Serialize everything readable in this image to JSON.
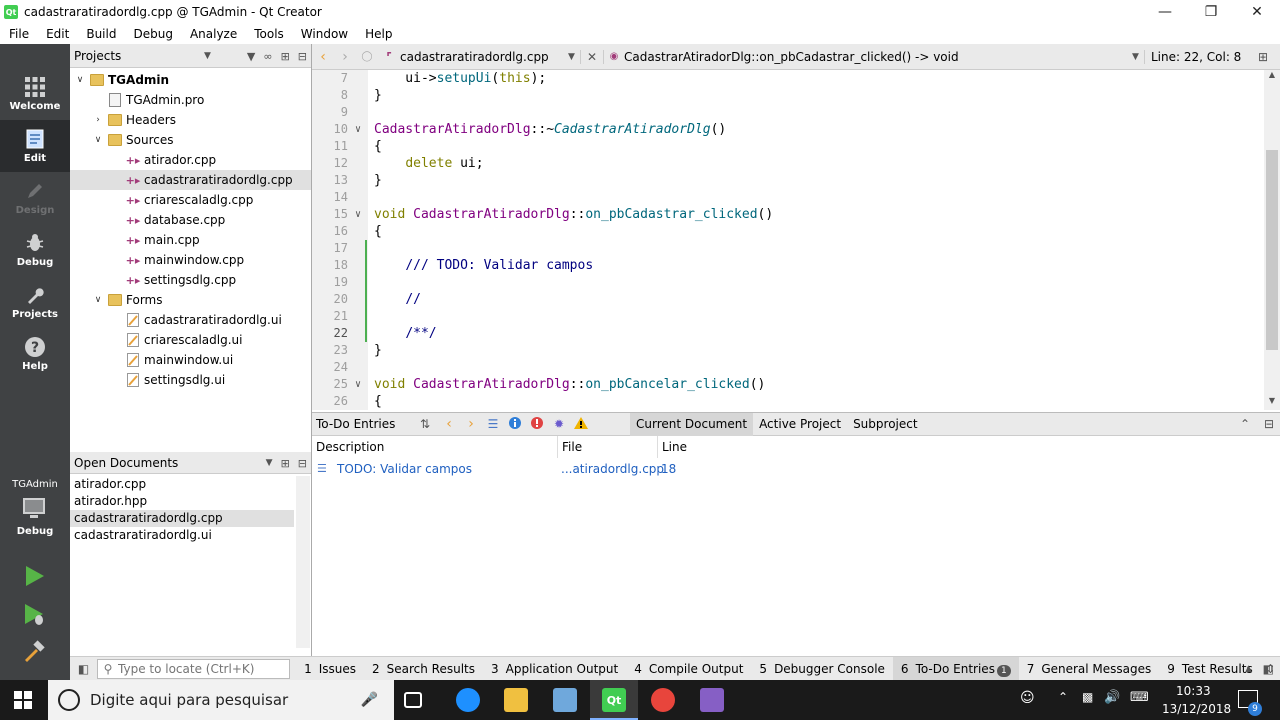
{
  "window": {
    "title": "cadastraratiradordlg.cpp @ TGAdmin - Qt Creator"
  },
  "menu": [
    "File",
    "Edit",
    "Build",
    "Debug",
    "Analyze",
    "Tools",
    "Window",
    "Help"
  ],
  "modes": [
    {
      "label": "Welcome",
      "icon": "grid-icon"
    },
    {
      "label": "Edit",
      "icon": "document-icon"
    },
    {
      "label": "Design",
      "icon": "pencil-icon"
    },
    {
      "label": "Debug",
      "icon": "bug-icon"
    },
    {
      "label": "Projects",
      "icon": "wrench-icon"
    },
    {
      "label": "Help",
      "icon": "question-icon"
    }
  ],
  "kit": {
    "project": "TGAdmin",
    "build": "Debug"
  },
  "projects_pane": {
    "title": "Projects",
    "tree": [
      {
        "label": "TGAdmin",
        "level": 0,
        "type": "project",
        "expanded": true
      },
      {
        "label": "TGAdmin.pro",
        "level": 1,
        "type": "pro"
      },
      {
        "label": "Headers",
        "level": 1,
        "type": "folder",
        "expanded": false
      },
      {
        "label": "Sources",
        "level": 1,
        "type": "folder",
        "expanded": true
      },
      {
        "label": "atirador.cpp",
        "level": 2,
        "type": "cpp"
      },
      {
        "label": "cadastraratiradordlg.cpp",
        "level": 2,
        "type": "cpp",
        "selected": true
      },
      {
        "label": "criarescaladlg.cpp",
        "level": 2,
        "type": "cpp"
      },
      {
        "label": "database.cpp",
        "level": 2,
        "type": "cpp"
      },
      {
        "label": "main.cpp",
        "level": 2,
        "type": "cpp"
      },
      {
        "label": "mainwindow.cpp",
        "level": 2,
        "type": "cpp"
      },
      {
        "label": "settingsdlg.cpp",
        "level": 2,
        "type": "cpp"
      },
      {
        "label": "Forms",
        "level": 1,
        "type": "folder",
        "expanded": true
      },
      {
        "label": "cadastraratiradordlg.ui",
        "level": 2,
        "type": "ui"
      },
      {
        "label": "criarescaladlg.ui",
        "level": 2,
        "type": "ui"
      },
      {
        "label": "mainwindow.ui",
        "level": 2,
        "type": "ui"
      },
      {
        "label": "settingsdlg.ui",
        "level": 2,
        "type": "ui"
      }
    ]
  },
  "open_documents": {
    "title": "Open Documents",
    "items": [
      "atirador.cpp",
      "atirador.hpp",
      "cadastraratiradordlg.cpp",
      "cadastraratiradordlg.ui"
    ],
    "selected": 2
  },
  "editor_toolbar": {
    "file": "cadastraratiradordlg.cpp",
    "symbol": "CadastrarAtiradorDlg::on_pbCadastrar_clicked() -> void",
    "position": "Line: 22, Col: 8"
  },
  "code_lines": [
    {
      "n": "7",
      "fold": "",
      "segs": [
        [
          "",
          "    ui->"
        ],
        [
          "fn",
          "setupUi"
        ],
        [
          "",
          "("
        ],
        [
          "kw",
          "this"
        ],
        [
          "",
          ");"
        ]
      ]
    },
    {
      "n": "8",
      "fold": "",
      "segs": [
        [
          "",
          "}"
        ]
      ]
    },
    {
      "n": "9",
      "fold": "",
      "segs": []
    },
    {
      "n": "10",
      "fold": "v",
      "segs": [
        [
          "cls",
          "CadastrarAtiradorDlg"
        ],
        [
          "",
          "::~"
        ],
        [
          "fni",
          "CadastrarAtiradorDlg"
        ],
        [
          "",
          "()"
        ]
      ]
    },
    {
      "n": "11",
      "fold": "",
      "segs": [
        [
          "",
          "{"
        ]
      ]
    },
    {
      "n": "12",
      "fold": "",
      "segs": [
        [
          "",
          "    "
        ],
        [
          "kw",
          "delete"
        ],
        [
          "",
          " ui;"
        ]
      ]
    },
    {
      "n": "13",
      "fold": "",
      "segs": [
        [
          "",
          "}"
        ]
      ]
    },
    {
      "n": "14",
      "fold": "",
      "segs": []
    },
    {
      "n": "15",
      "fold": "v",
      "segs": [
        [
          "kw",
          "void"
        ],
        [
          "",
          " "
        ],
        [
          "cls",
          "CadastrarAtiradorDlg"
        ],
        [
          "",
          "::"
        ],
        [
          "fn",
          "on_pbCadastrar_clicked"
        ],
        [
          "",
          "()"
        ]
      ]
    },
    {
      "n": "16",
      "fold": "",
      "segs": [
        [
          "",
          "{"
        ]
      ]
    },
    {
      "n": "17",
      "fold": "",
      "segs": [],
      "changed": true
    },
    {
      "n": "18",
      "fold": "",
      "segs": [
        [
          "",
          "    "
        ],
        [
          "cmt",
          "/// TODO: Validar campos"
        ]
      ],
      "changed": true
    },
    {
      "n": "19",
      "fold": "",
      "segs": [],
      "changed": true
    },
    {
      "n": "20",
      "fold": "",
      "segs": [
        [
          "",
          "    "
        ],
        [
          "cmt",
          "//"
        ]
      ],
      "changed": true
    },
    {
      "n": "21",
      "fold": "",
      "segs": [],
      "changed": true
    },
    {
      "n": "22",
      "fold": "",
      "segs": [
        [
          "",
          "    "
        ],
        [
          "cmt",
          "/**/"
        ]
      ],
      "changed": true,
      "current": true
    },
    {
      "n": "23",
      "fold": "",
      "segs": [
        [
          "",
          "}"
        ]
      ]
    },
    {
      "n": "24",
      "fold": "",
      "segs": []
    },
    {
      "n": "25",
      "fold": "v",
      "segs": [
        [
          "kw",
          "void"
        ],
        [
          "",
          " "
        ],
        [
          "cls",
          "CadastrarAtiradorDlg"
        ],
        [
          "",
          "::"
        ],
        [
          "fn",
          "on_pbCancelar_clicked"
        ],
        [
          "",
          "()"
        ]
      ]
    },
    {
      "n": "26",
      "fold": "",
      "segs": [
        [
          "",
          "{"
        ]
      ]
    }
  ],
  "todo": {
    "title": "To-Do Entries",
    "scopes": [
      "Current Document",
      "Active Project",
      "Subproject"
    ],
    "active_scope": 0,
    "columns": [
      "Description",
      "File",
      "Line"
    ],
    "rows": [
      {
        "description": "TODO: Validar campos",
        "file": "...atiradordlg.cpp",
        "line": "18"
      }
    ]
  },
  "locator": {
    "placeholder": "Type to locate (Ctrl+K)"
  },
  "output_tabs": [
    {
      "num": "1",
      "label": "Issues"
    },
    {
      "num": "2",
      "label": "Search Results"
    },
    {
      "num": "3",
      "label": "Application Output"
    },
    {
      "num": "4",
      "label": "Compile Output"
    },
    {
      "num": "5",
      "label": "Debugger Console"
    },
    {
      "num": "6",
      "label": "To-Do Entries",
      "badge": "1",
      "active": true
    },
    {
      "num": "7",
      "label": "General Messages"
    },
    {
      "num": "9",
      "label": "Test Results"
    }
  ],
  "taskbar": {
    "search_placeholder": "Digite aqui para pesquisar",
    "time": "10:33",
    "date": "13/12/2018",
    "notifications": "9"
  }
}
